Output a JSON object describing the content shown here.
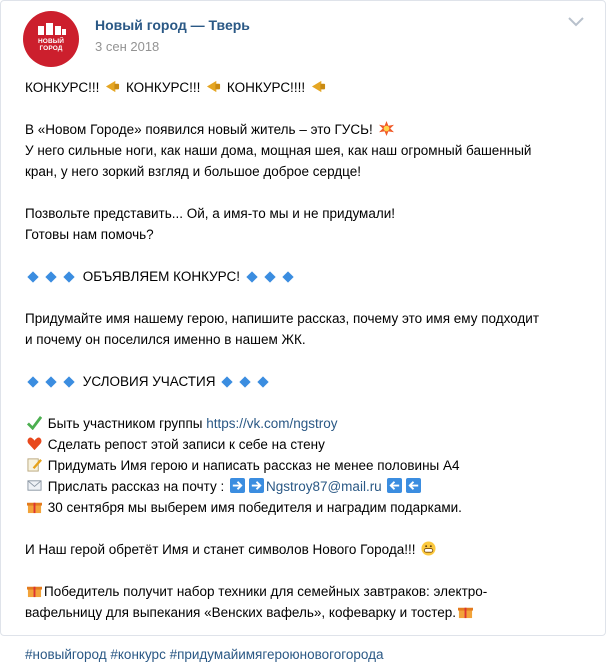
{
  "header": {
    "author": "Новый город — Тверь",
    "date": "3 сен 2018",
    "avatar_text": "НОВЫЙ ГОРОД"
  },
  "body": {
    "line1": "КОНКУРС!!!",
    "line1b": "КОНКУРС!!!",
    "line1c": "КОНКУРС!!!!",
    "p1_1": "В «Новом Городе» появился новый житель – это ГУСЬ!",
    "p1_2": "У него сильные ноги, как наши дома, мощная шея, как наш огромный башенный",
    "p1_3": "кран, у него зоркий взгляд и большое доброе сердце!",
    "p2_1": "Позвольте представить... Ой, а имя-то мы и не придумали!",
    "p2_2": "Готовы нам помочь?",
    "announce": "ОБЪЯВЛЯЕМ КОНКУРС!",
    "p3_1": "Придумайте имя нашему герою, напишите рассказ, почему это имя ему подходит",
    "p3_2": "и почему он поселился именно в нашем ЖК.",
    "conditions": "УСЛОВИЯ УЧАСТИЯ",
    "c1": "Быть участником группы ",
    "c1_link": "https://vk.com/ngstroy",
    "c2": "Сделать репост этой записи к себе на стену",
    "c3": "Придумать Имя герою и написать рассказ не менее половины А4",
    "c4": "Прислать рассказ на почту : ",
    "c4_link": "Ngstroy87@mail.ru",
    "c5": "30 сентября мы выберем имя победителя и наградим подарками.",
    "p4": "И Наш герой обретёт Имя и станет символов Нового Города!!!",
    "p5_1": "Победитель получит набор техники для семейных завтраков: электро-",
    "p5_2": "вафельницу для выпекания «Венских вафель», кофеварку и тостер.",
    "hashtags": "#новыйгород #конкурс #придумайимягероюновогогорода"
  },
  "colors": {
    "link": "#2a5885",
    "date": "#939393",
    "avatar": "#cc1f2d"
  }
}
